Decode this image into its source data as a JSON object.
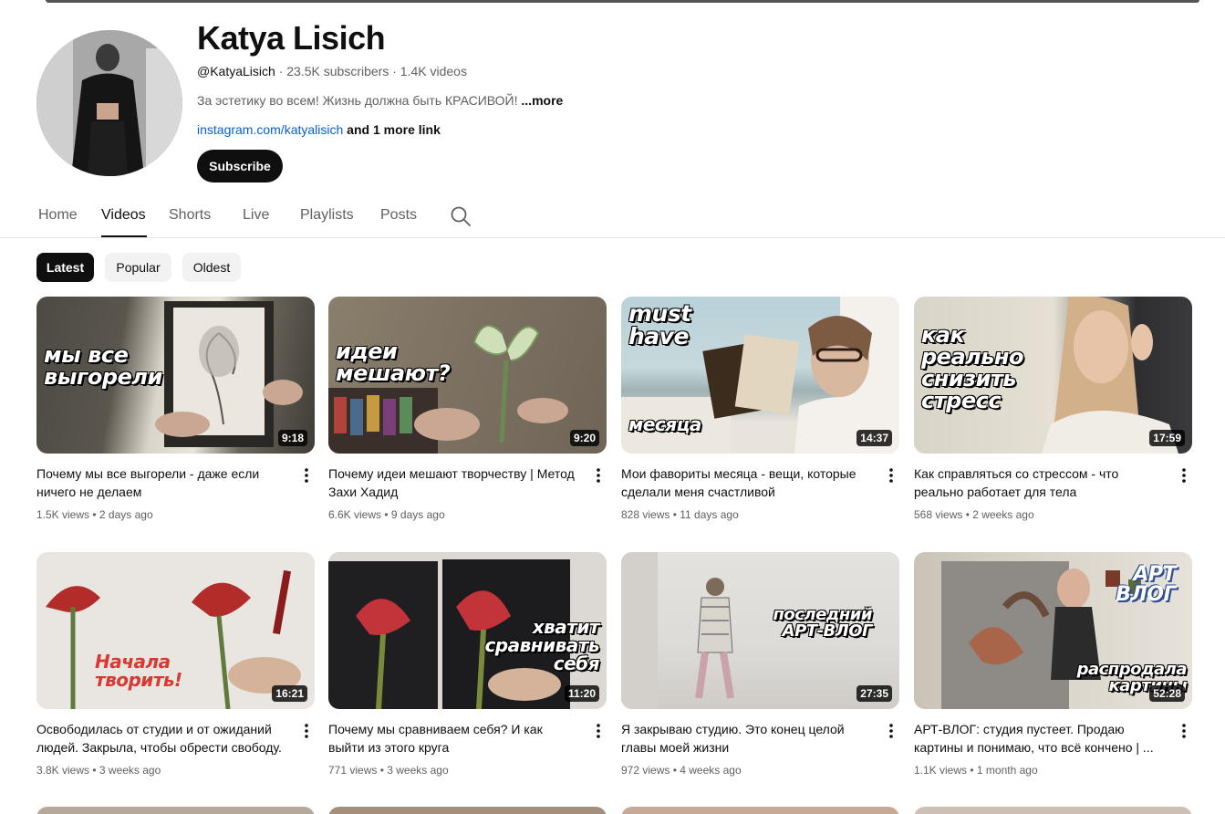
{
  "channel": {
    "name": "Katya Lisich",
    "handle": "@KatyaLisich",
    "subscribers": "23.5K subscribers",
    "videos_count": "1.4K videos",
    "description": "За эстетику во всем! Жизнь должна быть КРАСИВОЙ!",
    "more_label": "...more",
    "link": "instagram.com/katyalisich",
    "more_links": "and 1 more link",
    "subscribe_label": "Subscribe"
  },
  "tabs": [
    {
      "label": "Home"
    },
    {
      "label": "Videos"
    },
    {
      "label": "Shorts"
    },
    {
      "label": "Live"
    },
    {
      "label": "Playlists"
    },
    {
      "label": "Posts"
    }
  ],
  "chips": [
    {
      "label": "Latest"
    },
    {
      "label": "Popular"
    },
    {
      "label": "Oldest"
    }
  ],
  "videos": [
    {
      "title": "Почему мы все выгорели - даже если ничего не делаем",
      "views": "1.5K views",
      "age": "2 days ago",
      "duration": "9:18",
      "overlay": "мы все\nвыгорели"
    },
    {
      "title": "Почему идеи мешают творчеству | Метод Захи Хадид",
      "views": "6.6K views",
      "age": "9 days ago",
      "duration": "9:20",
      "overlay": "идеи\nмешают?"
    },
    {
      "title": "Мои фавориты месяца - вещи, которые сделали меня счастливой",
      "views": "828 views",
      "age": "11 days ago",
      "duration": "14:37",
      "overlay": "must\nhave",
      "overlay2": "месяца"
    },
    {
      "title": "Как справляться со стрессом - что реально работает для тела",
      "views": "568 views",
      "age": "2 weeks ago",
      "duration": "17:59",
      "overlay": "как\nреально\nснизить\nстресс"
    },
    {
      "title": "Освободилась от студии и от ожиданий людей. Закрыла, чтобы обрести свободу.",
      "views": "3.8K views",
      "age": "3 weeks ago",
      "duration": "16:21",
      "overlay": "Начала\nтворить!"
    },
    {
      "title": "Почему мы сравниваем себя? И как выйти из этого круга",
      "views": "771 views",
      "age": "3 weeks ago",
      "duration": "11:20",
      "overlay": "хватит\nсравнивать\nсебя"
    },
    {
      "title": "Я закрываю студию. Это конец целой главы моей жизни",
      "views": "972 views",
      "age": "4 weeks ago",
      "duration": "27:35",
      "overlay": "последний\nАРТ-ВЛОГ"
    },
    {
      "title": "АРТ-ВЛОГ: студия пустеет. Продаю картины и понимаю, что всё кончено | ...",
      "views": "1.1K views",
      "age": "1 month ago",
      "duration": "52:28",
      "overlay": "АРТ\nВЛОГ",
      "overlay2": "распродала\nкартины"
    }
  ],
  "colors": {
    "link": "#065fd4",
    "text_primary": "#0f0f0f",
    "text_secondary": "#606060",
    "chip_bg": "#f2f2f2"
  }
}
